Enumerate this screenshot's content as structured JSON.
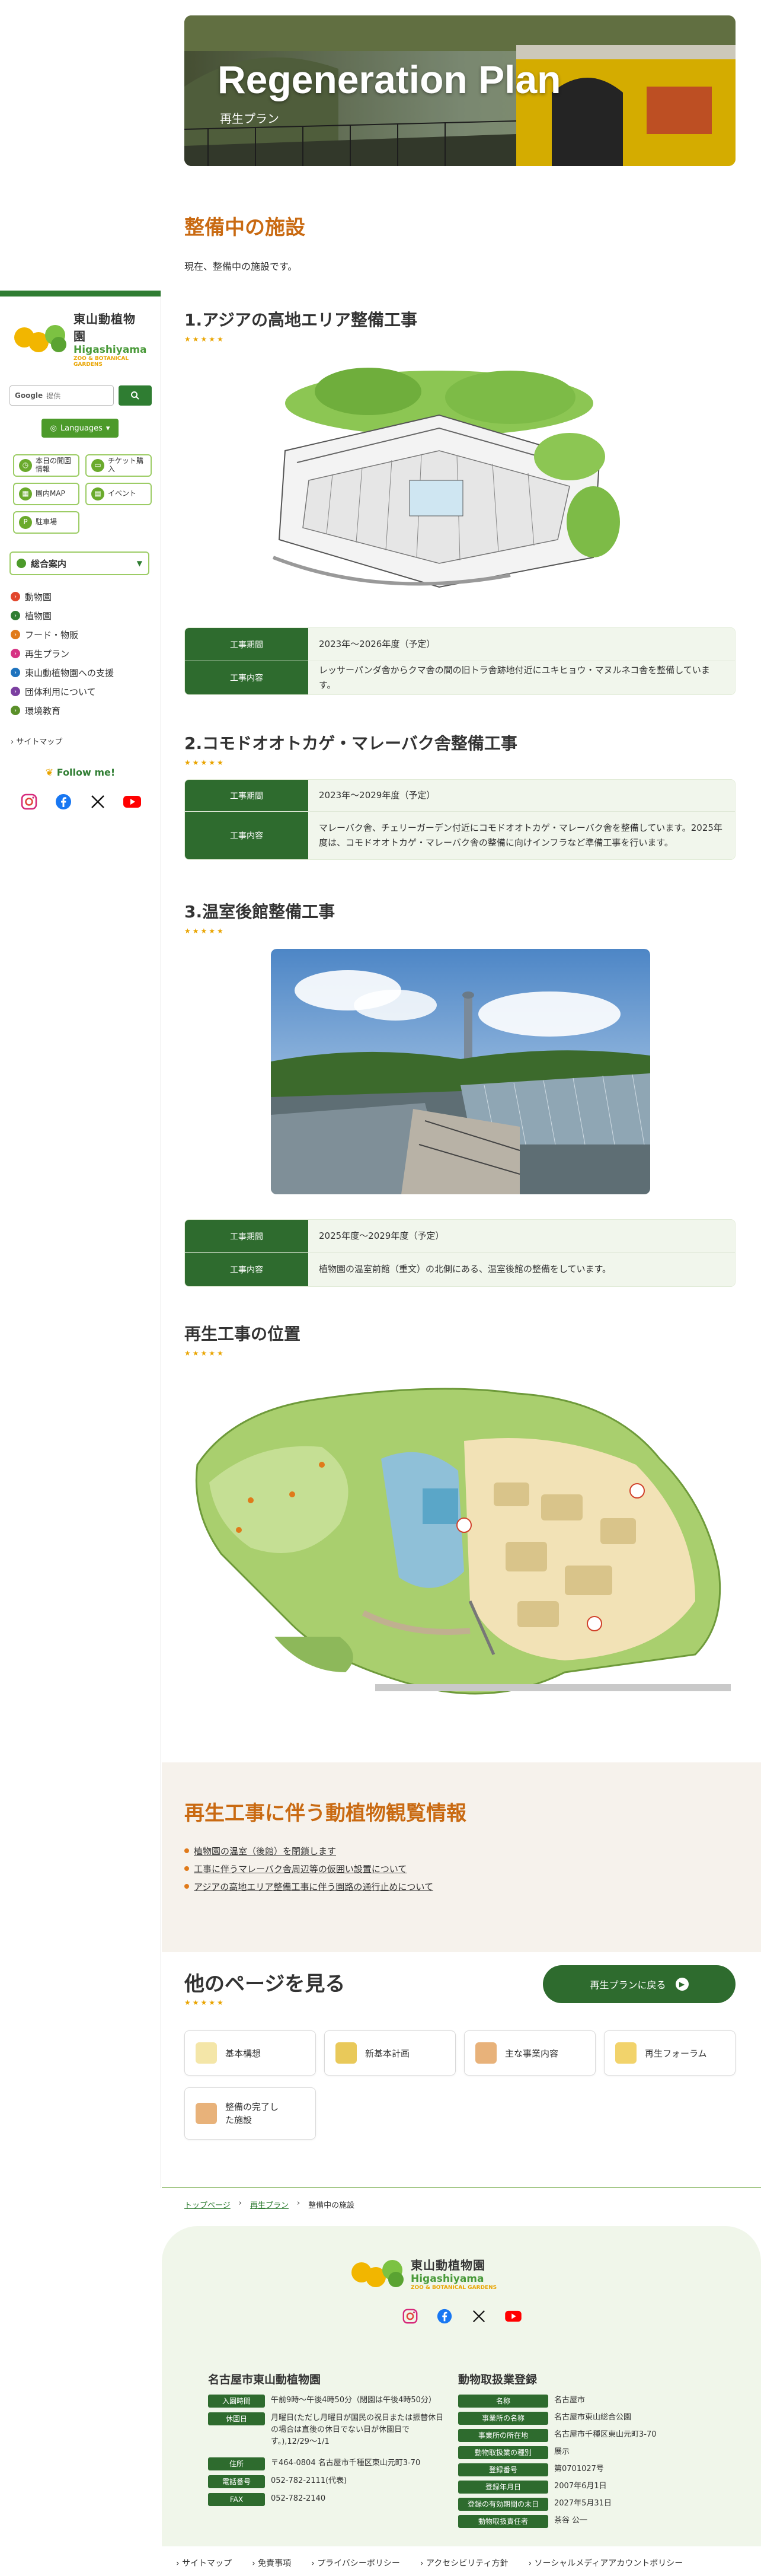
{
  "sidebar": {
    "logo": {
      "jp": "東山動植物園",
      "en1": "Higashiyama",
      "en2": "ZOO & BOTANICAL GARDENS"
    },
    "search": {
      "brand": "Google",
      "placeholder": "提供"
    },
    "language_label": "Languages",
    "quick_links": [
      {
        "label": "本日の開園情報",
        "icon": "clock-icon"
      },
      {
        "label": "チケット購入",
        "icon": "ticket-icon"
      },
      {
        "label": "園内MAP",
        "icon": "map-icon"
      },
      {
        "label": "イベント",
        "icon": "calendar-icon"
      },
      {
        "label": "駐車場",
        "icon": "parking-icon"
      }
    ],
    "guide_label": "総合案内",
    "nav": [
      {
        "label": "動物園",
        "color": "#e2462c"
      },
      {
        "label": "植物園",
        "color": "#2f7d32"
      },
      {
        "label": "フード・物販",
        "color": "#e07a1a"
      },
      {
        "label": "再生プラン",
        "color": "#d63384"
      },
      {
        "label": "東山動植物園への支援",
        "color": "#1e73be"
      },
      {
        "label": "団体利用について",
        "color": "#7b3fa0"
      },
      {
        "label": "環境教育",
        "color": "#5a8f29"
      }
    ],
    "sitemap": "サイトマップ",
    "follow": "Follow me!"
  },
  "hero": {
    "title": "Regeneration Plan",
    "subtitle": "再生プラン"
  },
  "page": {
    "heading": "整備中の施設",
    "description": "現在、整備中の施設です。",
    "stars": "★★★★★"
  },
  "projects": [
    {
      "title": "1.アジアの高地エリア整備工事",
      "rows": [
        {
          "key": "工事期間",
          "value": "2023年～2026年度（予定）"
        },
        {
          "key": "工事内容",
          "value": "レッサーパンダ舎からクマ舎の間の旧トラ舎跡地付近にユキヒョウ・マヌルネコ舎を整備しています。"
        }
      ]
    },
    {
      "title": "2.コモドオオトカゲ・マレーバク舎整備工事",
      "rows": [
        {
          "key": "工事期間",
          "value": "2023年～2029年度（予定）"
        },
        {
          "key": "工事内容",
          "value": "マレーバク舎、チェリーガーデン付近にコモドオオトカゲ・マレーバク舎を整備しています。2025年度は、コモドオオトカゲ・マレーバク舎の整備に向けインフラなど準備工事を行います。"
        }
      ]
    },
    {
      "title": "3.温室後館整備工事",
      "rows": [
        {
          "key": "工事期間",
          "value": "2025年度～2029年度（予定）"
        },
        {
          "key": "工事内容",
          "value": "植物園の温室前館（重文）の北側にある、温室後館の整備をしています。"
        }
      ]
    }
  ],
  "location_title": "再生工事の位置",
  "watch": {
    "title": "再生工事に伴う動植物観覧情報",
    "items": [
      "植物園の温室（後館）を閉鎖します",
      "工事に伴うマレーバク舎周辺等の仮囲い設置について",
      "アジアの高地エリア整備工事に伴う園路の通行止めについて"
    ]
  },
  "other": {
    "title": "他のページを見る",
    "back_button": "再生プランに戻る",
    "cards": [
      "基本構想",
      "新基本計画",
      "主な事業内容",
      "再生フォーラム",
      "整備の完了した施設"
    ]
  },
  "breadcrumb": [
    "トップページ",
    "再生プラン",
    "整備中の施設"
  ],
  "footer": {
    "org_title": "名古屋市東山動植物園",
    "org_rows": [
      {
        "key": "入園時間",
        "value": "午前9時～午後4時50分（閉園は午後4時50分）"
      },
      {
        "key": "休園日",
        "value": "月曜日(ただし月曜日が国民の祝日または振替休日の場合は直後の休日でない日が休園日です。),12/29～1/1"
      },
      {
        "key": "住所",
        "value": "〒464-0804 名古屋市千種区東山元町3-70"
      },
      {
        "key": "電話番号",
        "value": "052-782-2111(代表)"
      },
      {
        "key": "FAX",
        "value": "052-782-2140"
      }
    ],
    "reg_title": "動物取扱業登録",
    "reg_rows": [
      {
        "key": "名称",
        "value": "名古屋市"
      },
      {
        "key": "事業所の名称",
        "value": "名古屋市東山総合公園"
      },
      {
        "key": "事業所の所在地",
        "value": "名古屋市千種区東山元町3-70"
      },
      {
        "key": "動物取扱業の種別",
        "value": "展示"
      },
      {
        "key": "登録番号",
        "value": "第0701027号"
      },
      {
        "key": "登録年月日",
        "value": "2007年6月1日"
      },
      {
        "key": "登録の有効期間の末日",
        "value": "2027年5月31日"
      },
      {
        "key": "動物取扱責任者",
        "value": "茶谷 公一"
      }
    ],
    "links": [
      "サイトマップ",
      "免責事項",
      "プライバシーポリシー",
      "アクセシビリティ方針",
      "ソーシャルメディアアカウントポリシー"
    ]
  },
  "colors": {
    "accent_green": "#2f7d32",
    "heading_orange": "#c96a12",
    "star_yellow": "#e9a400"
  }
}
